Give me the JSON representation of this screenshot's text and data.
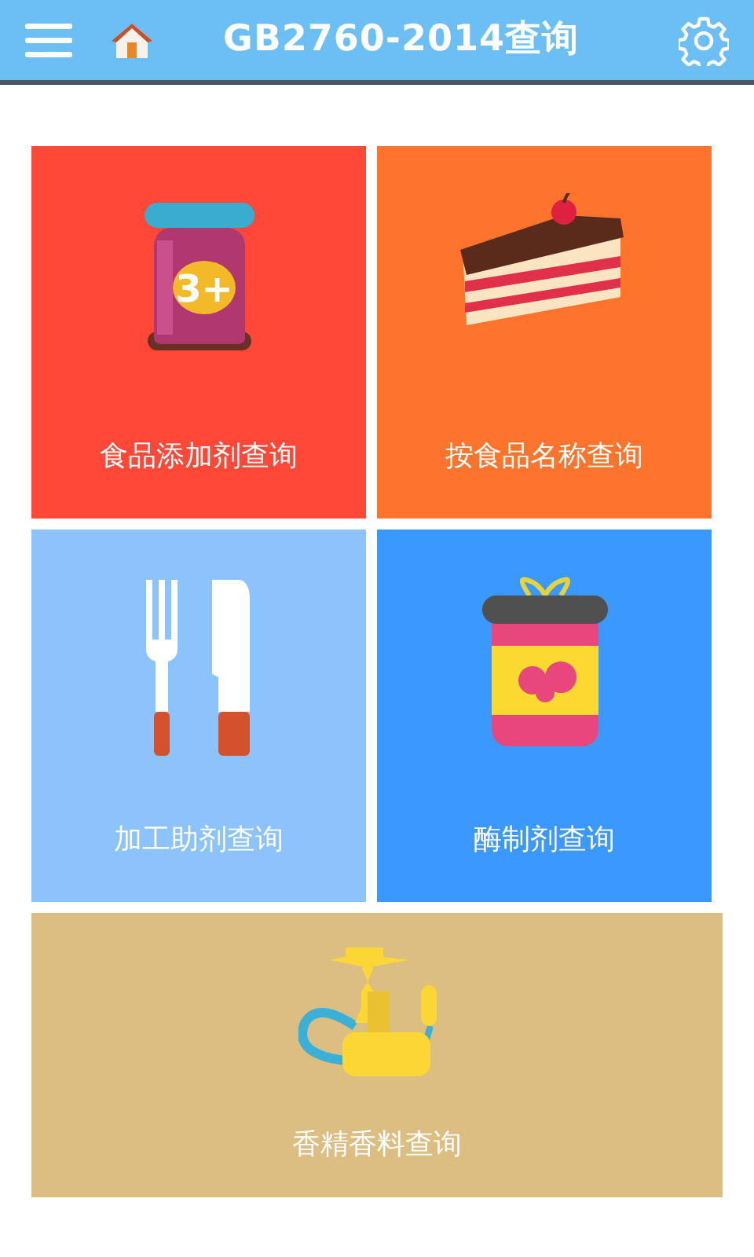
{
  "header": {
    "title": "GB2760-2014查询"
  },
  "tiles": [
    {
      "kind": "jar",
      "label": "食品添加剂查询",
      "color": "#ff4838",
      "icon_text": "3+"
    },
    {
      "kind": "cake",
      "label": "按食品名称查询",
      "color": "#ff742c"
    },
    {
      "kind": "cutlery",
      "label": "加工助剂查询",
      "color": "#8cc3fc"
    },
    {
      "kind": "can",
      "label": "酶制剂查询",
      "color": "#3a98fe"
    },
    {
      "kind": "hookah",
      "label": "香精香料查询",
      "color": "#dcbd82"
    }
  ]
}
